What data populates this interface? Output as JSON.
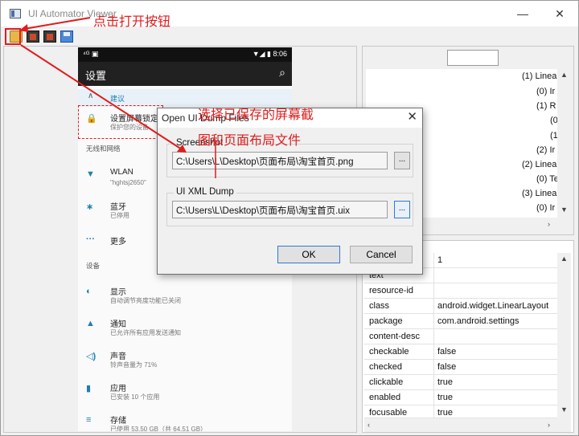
{
  "window": {
    "title": "UI Automator Viewer",
    "minimize": "—",
    "maximize": "☐",
    "close": "✕"
  },
  "annotations": {
    "click_open": "点击打开按钮",
    "select_files_line1": "选择已保存的屏幕截",
    "select_files_line2": "图和页面布局文件"
  },
  "phone": {
    "status_left": "⁴ᴳ ▣",
    "status_right": "▼◢ ▮ 8:06",
    "appbar_title": "设置",
    "search_icon": "⌕",
    "suggest_label": "建议",
    "sec_header_wireless": "无线和网络",
    "sec_header_device": "设备",
    "items": [
      {
        "icon": "🔒",
        "title": "设置屏幕锁定",
        "sub": "保护您的设备"
      },
      {
        "icon": "▼",
        "title": "WLAN",
        "sub": "\"hghtsj2650\""
      },
      {
        "icon": "∗",
        "title": "蓝牙",
        "sub": "已停用"
      },
      {
        "icon": "···",
        "title": "更多",
        "sub": ""
      },
      {
        "icon": "◐",
        "title": "显示",
        "sub": "自动调节亮度功能已关闭"
      },
      {
        "icon": "▲",
        "title": "通知",
        "sub": "已允许所有应用发送通知"
      },
      {
        "icon": "◁)",
        "title": "声音",
        "sub": "铃声音量为 71%"
      },
      {
        "icon": "▮",
        "title": "应用",
        "sub": "已安装 10 个应用"
      },
      {
        "icon": "≡",
        "title": "存储",
        "sub": "已使用 53.50 GB（共 64.51 GB）"
      }
    ]
  },
  "tree": {
    "nodes": [
      "(1) Linea",
      "(0) Ir",
      "(1) R",
      "(0",
      "(1",
      "(2) Ir",
      "(2) Linea",
      "(0) Te",
      "(3) Linea",
      "(0) Ir"
    ]
  },
  "props": {
    "rows": [
      {
        "key": "",
        "value": "1"
      },
      {
        "key": "text",
        "value": ""
      },
      {
        "key": "resource-id",
        "value": ""
      },
      {
        "key": "class",
        "value": "android.widget.LinearLayout"
      },
      {
        "key": "package",
        "value": "com.android.settings"
      },
      {
        "key": "content-desc",
        "value": ""
      },
      {
        "key": "checkable",
        "value": "false"
      },
      {
        "key": "checked",
        "value": "false"
      },
      {
        "key": "clickable",
        "value": "true"
      },
      {
        "key": "enabled",
        "value": "true"
      },
      {
        "key": "focusable",
        "value": "true"
      }
    ]
  },
  "dialog": {
    "title": "Open UI Dump Files",
    "close": "✕",
    "screenshot_label": "Screenshot",
    "screenshot_path": "C:\\Users\\L\\Desktop\\页面布局\\淘宝首页.png",
    "xml_label": "UI XML Dump",
    "xml_path": "C:\\Users\\L\\Desktop\\页面布局\\淘宝首页.uix",
    "browse": "...",
    "ok": "OK",
    "cancel": "Cancel"
  },
  "colors": {
    "annotation_red": "#e01c1c",
    "accent_blue": "#1c7fb5"
  }
}
